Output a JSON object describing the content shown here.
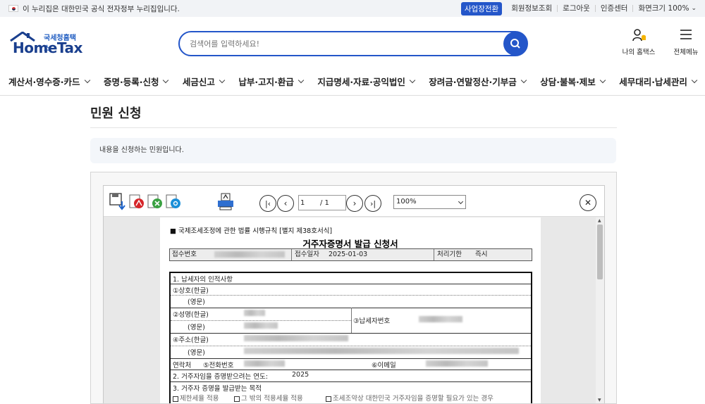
{
  "govbar": {
    "notice": "이 누리집은 대한민국 공식 전자정부 누리집입니다.",
    "business_switch": "사업장전환",
    "links": [
      "회원정보조회",
      "로그아웃",
      "인증센터"
    ],
    "zoom_label": "화면크기 100%"
  },
  "header": {
    "logo_sub": "국세청홈택스",
    "logo_main": "HomeTax",
    "search_placeholder": "검색어를 입력하세요!",
    "my_hometax": "나의 홈택스",
    "all_menu": "전체메뉴"
  },
  "nav": {
    "items": [
      "계산서·영수증·카드",
      "증명·등록·신청",
      "세금신고",
      "납부·고지·환급",
      "지급명세·자료·공익법인",
      "장려금·연말정산·기부금",
      "상담·불복·제보",
      "세무대리·납세관리"
    ]
  },
  "page": {
    "title": "민원 신청",
    "info": "내용을 신청하는 민원입니다."
  },
  "viewer": {
    "page_current": "1",
    "page_total": "/ 1",
    "zoom": "100%"
  },
  "document": {
    "form_ref": "■ 국제조세조정에 관한 법률 시행규칙 [별지 제38호서식]",
    "title": "거주자증명서 발급 신청서",
    "receipt_no_label": "접수번호",
    "receipt_date_label": "접수일자",
    "receipt_date": "2025-01-03",
    "period_label": "처리기한",
    "period_value": "즉시",
    "sec1": "1. 납세자의 인적사항",
    "trade_name_kr": "①상호(한글)",
    "trade_name_en": "(영문)",
    "name_kr": "②성명(한글)",
    "name_en": "(영문)",
    "taxpayer_no": "③납세자번호",
    "address_kr": "④주소(한글)",
    "address_en": "(영문)",
    "contact": "연락처",
    "phone": "⑤전화번호",
    "email": "⑥이메일",
    "sec2": "2. 거주자임을 증명받으려는 연도:",
    "year": "2025",
    "sec3": "3. 거주자 증명을 발급받는 목적",
    "purpose1": "제한세율 적용",
    "purpose2": "그 밖의 적용세율 적용",
    "purpose3": "조세조약상 대한민국 거주자임을 증명할 필요가 있는 경우"
  },
  "colors": {
    "accent": "#2456c9",
    "logo": "#1a3f8e"
  }
}
